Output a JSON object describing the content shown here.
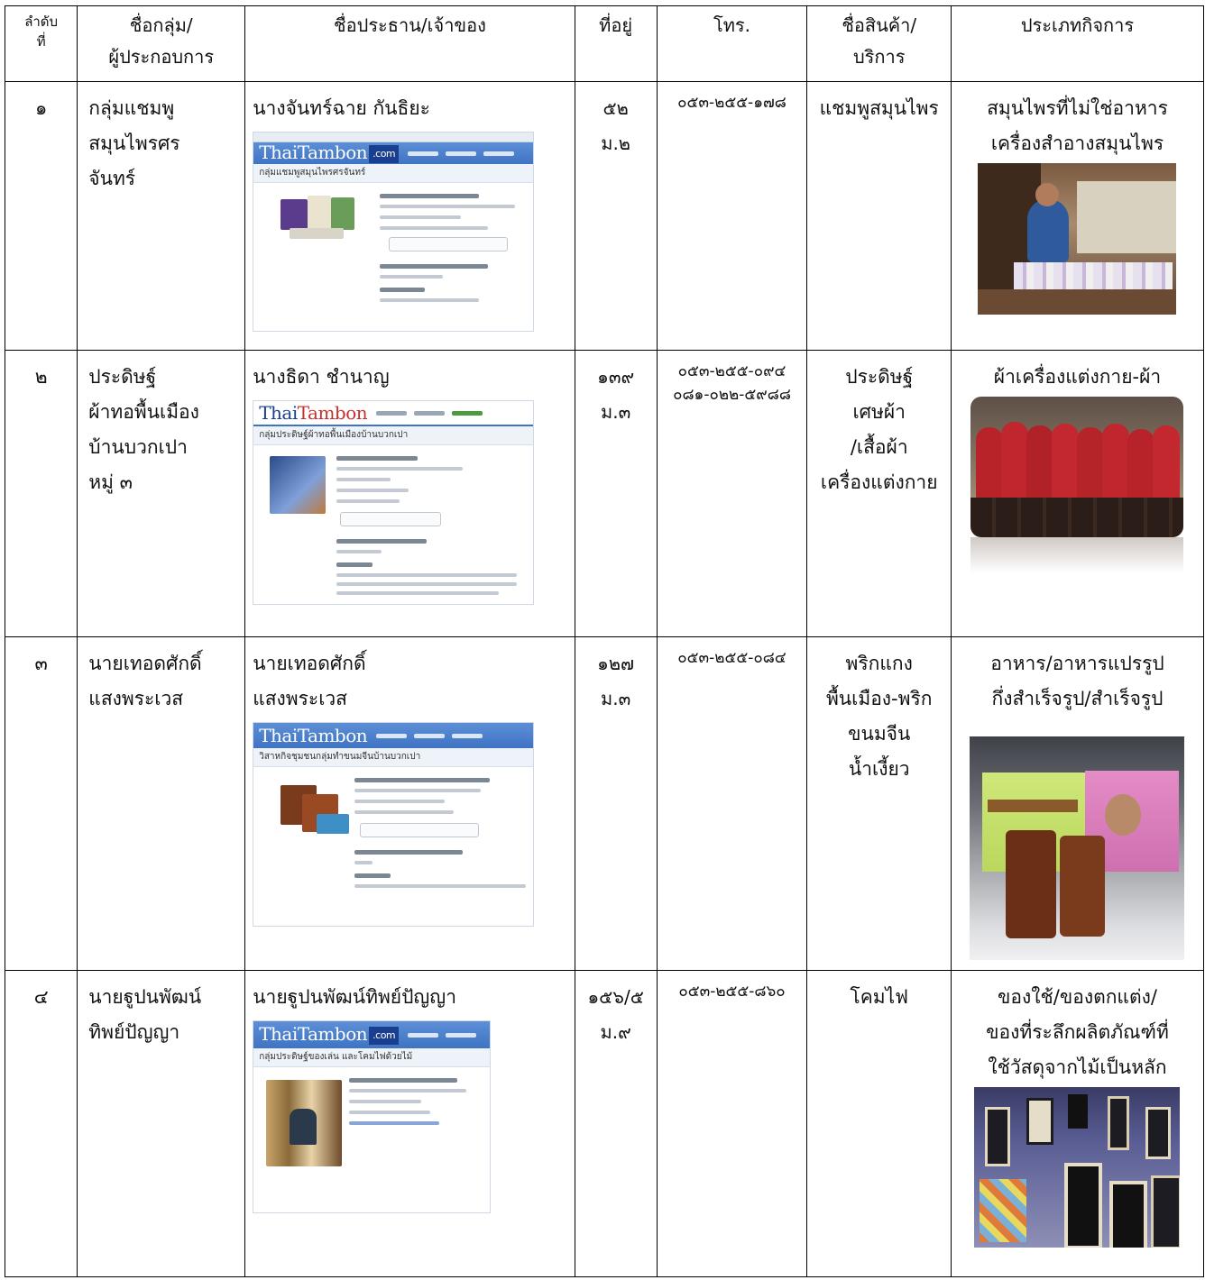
{
  "header": {
    "no": [
      "ลำดับ",
      "ที่"
    ],
    "group": [
      "ชื่อกลุ่ม/",
      "ผู้ประกอบการ"
    ],
    "owner": "ชื่อประธาน/เจ้าของ",
    "address": "ที่อยู่",
    "phone": "โทร.",
    "product": [
      "ชื่อสินค้า/",
      "บริการ"
    ],
    "business_type": "ประเภทกิจการ"
  },
  "rows": [
    {
      "no": "๑",
      "group": [
        "กลุ่มแชมพู",
        "สมุนไพรศร",
        "จันทร์"
      ],
      "owner": [
        "นางจันทร์ฉาย กันธิยะ"
      ],
      "address": [
        "๕๒",
        "ม.๒"
      ],
      "phone": [
        "๐๕๓-๒๕๕-๑๗๘"
      ],
      "product": [
        "แชมพูสมุนไพร"
      ],
      "business_type": [
        "สมุนไพรที่ไม่ใช่อาหาร",
        "เครื่องสำอางสมุนไพร"
      ]
    },
    {
      "no": "๒",
      "group": [
        "ประดิษฐ์",
        "ผ้าทอพื้นเมือง",
        "บ้านบวกเปา",
        "หมู่ ๓"
      ],
      "owner": [
        "นางธิดา ชำนาญ"
      ],
      "address": [
        "๑๓๙",
        "ม.๓"
      ],
      "phone": [
        "๐๕๓-๒๕๕-๐๙๔",
        "๐๘๑-๐๒๒-๕๙๘๘"
      ],
      "product": [
        "ประดิษฐ์",
        "เศษผ้า",
        "/เสื้อผ้า",
        "เครื่องแต่งกาย"
      ],
      "business_type": [
        "ผ้าเครื่องแต่งกาย-ผ้า"
      ]
    },
    {
      "no": "๓",
      "group": [
        "นายเทอดศักดิ์",
        "แสงพระเวส"
      ],
      "owner": [
        "นายเทอดศักดิ์",
        "แสงพระเวส"
      ],
      "address": [
        "๑๒๗",
        "ม.๓"
      ],
      "phone": [
        "๐๕๓-๒๕๕-๐๘๔"
      ],
      "product": [
        "พริกแกง",
        "พื้นเมือง-พริก",
        "ขนมจีน",
        "น้ำเงี้ยว"
      ],
      "business_type": [
        "อาหาร/อาหารแปรรูป",
        "กึ่งสำเร็จรูป/สำเร็จรูป"
      ]
    },
    {
      "no": "๔",
      "group": [
        "นายฐูปนพัฒน์",
        "ทิพย์ปัญญา"
      ],
      "owner": [
        "นายฐูปนพัฒน์ทิพย์ปัญญา"
      ],
      "address": [
        "๑๕๖/๕",
        "ม.๙"
      ],
      "phone": [
        "๐๕๓-๒๕๕-๘๖๐"
      ],
      "product": [
        "โคมไฟ"
      ],
      "business_type": [
        "ของใช้/ของตกแต่ง/",
        "ของที่ระลึกผลิตภัณฑ์ที่",
        "ใช้วัสดุจากไม้เป็นหลัก"
      ]
    }
  ],
  "screenshots": [
    {
      "page_title": "กลุ่มแชมพูสมุนไพรศรจันทร์"
    },
    {
      "page_title": "กลุ่มประดิษฐ์ผ้าทอพื้นเมืองบ้านบวกเปา"
    },
    {
      "page_title": "วิสาหกิจชุมชนกลุ่มทำขนมจีนบ้านบวกเปา"
    },
    {
      "page_title": "กลุ่มประดิษฐ์ของเล่น และโคมไฟด้วยไม้"
    }
  ],
  "logo": {
    "part1": "Thai",
    "part2": "Tambon",
    "suffix": ".com"
  }
}
